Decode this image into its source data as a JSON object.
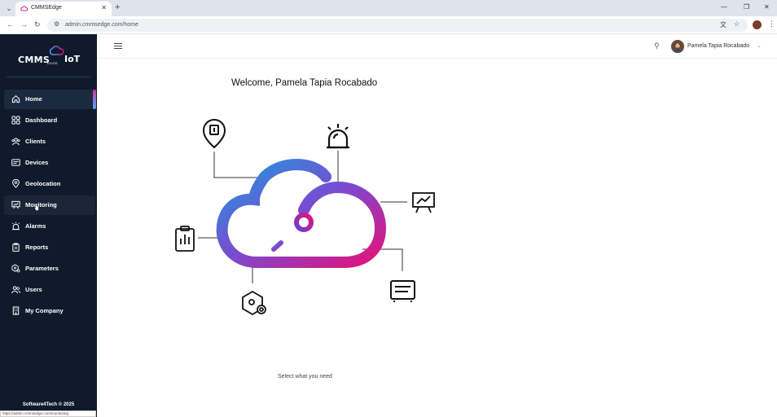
{
  "browser": {
    "tab_title": "CMMSEdge",
    "url": "admin.cmmsedge.com/home",
    "status_url": "https://admin.cmmsedge.com/monitoring"
  },
  "brand": {
    "logo_main": "CMMS",
    "logo_sub": "EDGE",
    "logo_suffix": "IoT",
    "accent_pink": "#e3127a",
    "accent_blue": "#1e9ae0",
    "sidebar_bg": "#0f1b2d"
  },
  "sidebar": {
    "items": [
      {
        "label": "Home",
        "icon": "home-icon"
      },
      {
        "label": "Dashboard",
        "icon": "dashboard-icon"
      },
      {
        "label": "Clients",
        "icon": "clients-icon"
      },
      {
        "label": "Devices",
        "icon": "devices-icon"
      },
      {
        "label": "Geolocation",
        "icon": "location-icon"
      },
      {
        "label": "Monitoring",
        "icon": "monitoring-icon"
      },
      {
        "label": "Alarms",
        "icon": "alarm-icon"
      },
      {
        "label": "Reports",
        "icon": "reports-icon"
      },
      {
        "label": "Parameters",
        "icon": "parameters-icon"
      },
      {
        "label": "Users",
        "icon": "users-icon"
      },
      {
        "label": "My Company",
        "icon": "company-icon"
      }
    ],
    "active": "Home",
    "footer": "Software4Tech © 2025"
  },
  "header": {
    "user_name": "Pamela Tapia Rocabado"
  },
  "main": {
    "welcome": "Welcome, Pamela Tapia Rocabado",
    "hint": "Select what you need"
  }
}
